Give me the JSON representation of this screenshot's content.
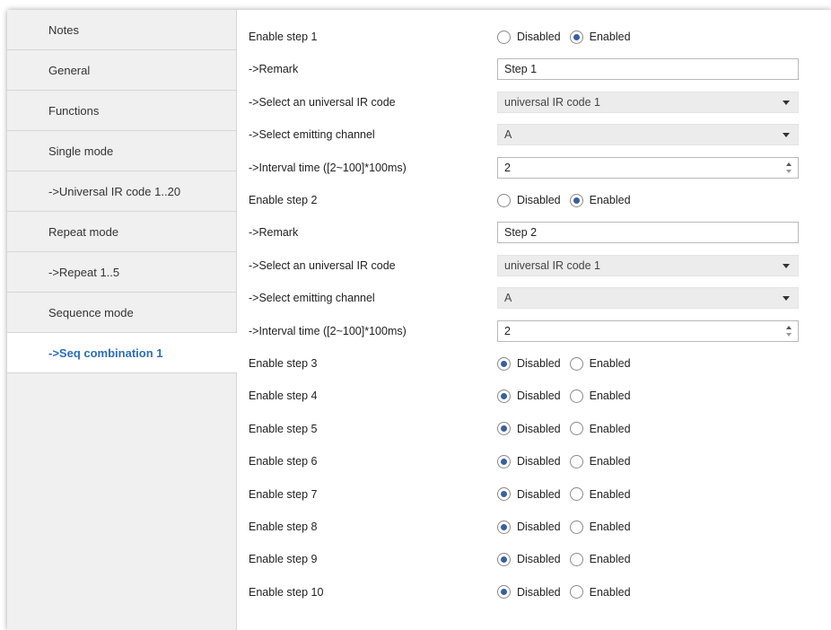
{
  "sidebar": {
    "items": [
      {
        "label": "Notes",
        "active": false
      },
      {
        "label": "General",
        "active": false
      },
      {
        "label": "Functions",
        "active": false
      },
      {
        "label": "Single mode",
        "active": false
      },
      {
        "label": "->Universal IR code 1..20",
        "active": false
      },
      {
        "label": "Repeat mode",
        "active": false
      },
      {
        "label": "->Repeat 1..5",
        "active": false
      },
      {
        "label": "Sequence mode",
        "active": false
      },
      {
        "label": "->Seq combination 1",
        "active": true
      }
    ]
  },
  "options": {
    "disabled": "Disabled",
    "enabled": "Enabled"
  },
  "rows": [
    {
      "label": "Enable step 1",
      "type": "radio",
      "value": "enabled"
    },
    {
      "label": "->Remark",
      "type": "text",
      "value": "Step 1"
    },
    {
      "label": "->Select an universal IR code",
      "type": "select",
      "value": "universal IR code 1"
    },
    {
      "label": "->Select emitting channel",
      "type": "select",
      "value": "A"
    },
    {
      "label": "->Interval time ([2~100]*100ms)",
      "type": "spin",
      "value": "2"
    },
    {
      "label": "Enable step 2",
      "type": "radio",
      "value": "enabled"
    },
    {
      "label": "->Remark",
      "type": "text",
      "value": "Step 2"
    },
    {
      "label": "->Select an universal IR code",
      "type": "select",
      "value": "universal IR code 1"
    },
    {
      "label": "->Select emitting channel",
      "type": "select",
      "value": "A"
    },
    {
      "label": "->Interval time ([2~100]*100ms)",
      "type": "spin",
      "value": "2"
    },
    {
      "label": "Enable step 3",
      "type": "radio",
      "value": "disabled"
    },
    {
      "label": "Enable step 4",
      "type": "radio",
      "value": "disabled"
    },
    {
      "label": "Enable step 5",
      "type": "radio",
      "value": "disabled"
    },
    {
      "label": "Enable step 6",
      "type": "radio",
      "value": "disabled"
    },
    {
      "label": "Enable step 7",
      "type": "radio",
      "value": "disabled"
    },
    {
      "label": "Enable step 8",
      "type": "radio",
      "value": "disabled"
    },
    {
      "label": "Enable step 9",
      "type": "radio",
      "value": "disabled"
    },
    {
      "label": "Enable step 10",
      "type": "radio",
      "value": "disabled"
    }
  ],
  "colors": {
    "active_item_text": "#2a6ebb",
    "radio_dot": "#3a5f9e",
    "sidebar_bg": "#f0f0f0"
  }
}
